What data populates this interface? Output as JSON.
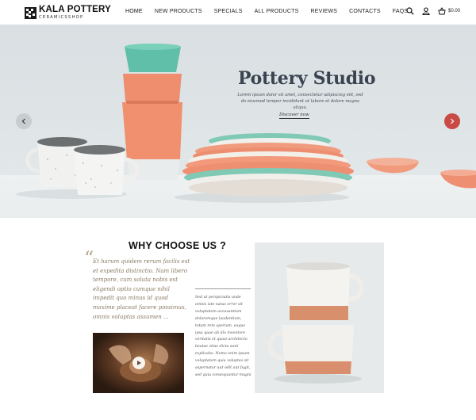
{
  "brand": {
    "name": "KALA POTTERY",
    "tagline": "CERAMICSSHOP"
  },
  "nav": {
    "items": [
      {
        "label": "HOME"
      },
      {
        "label": "NEW PRODUCTS"
      },
      {
        "label": "SPECIALS"
      },
      {
        "label": "ALL PRODUCTS"
      },
      {
        "label": "REVIEWS"
      },
      {
        "label": "CONTACTS"
      },
      {
        "label": "FAQS"
      }
    ]
  },
  "tools": {
    "search_icon": "search-icon",
    "account_icon": "user-icon",
    "cart_icon": "basket-icon",
    "cart_total": "$0.00"
  },
  "hero": {
    "title": "Pottery Studio",
    "text": "Lorem ipsum dolor sit amet, consectetur adipiscing elit, sed do eiusmod tempor incididunt ut labore et dolore magna aliqua.",
    "button": "Discover now",
    "colors": {
      "accent": "#c94b45",
      "teal": "#7fc9b5",
      "coral": "#ee8f72"
    }
  },
  "why": {
    "title": "WHY CHOOSE US ?",
    "quote": "Et harum quidem rerum facilis est et expedita distinctio. Nam libero tempore, cum soluta nobis est eligendi optio cumque nihil impedit quo minus id quod maxime placeat facere possimus, omnis voluptas assumen ...",
    "small_text": "Sed ut perspiciatis unde omnis iste natus error sit voluptatem accusantium doloremque laudantium, totam rem aperiam, eaque ipsa quae ab illo inventore veritatis et quasi architecto beatae vitae dicta sunt explicabo. Nemo enim ipsam voluptatem quia voluptas sit aspernatur aut odit aut fugit, sed quia consequuntur magni"
  }
}
